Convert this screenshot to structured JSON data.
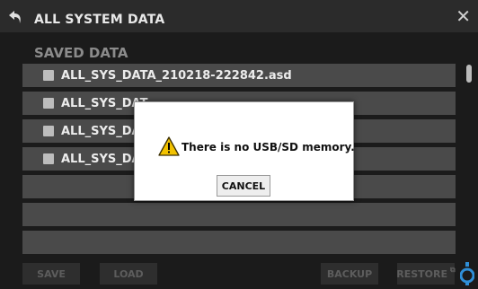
{
  "header": {
    "title": "ALL SYSTEM DATA"
  },
  "section": {
    "label": "SAVED DATA"
  },
  "files": [
    "ALL_SYS_DATA_210218-222842.asd",
    "ALL_SYS_DAT",
    "ALL_SYS_DAT",
    "ALL_SYS_DAT"
  ],
  "toolbar": {
    "save": "SAVE",
    "load": "LOAD",
    "backup": "BACKUP",
    "restore": "RESTORE"
  },
  "dialog": {
    "message": "There is no USB/SD memory.",
    "cancel": "CANCEL"
  },
  "colors": {
    "warning": "#f2c200",
    "list_row": "#4a4a4a",
    "knob": "#2f8fd8"
  },
  "icons": {
    "back": "back-arrow-icon",
    "close": "close-icon",
    "warning": "warning-icon",
    "knob": "encoder-knob-icon"
  }
}
